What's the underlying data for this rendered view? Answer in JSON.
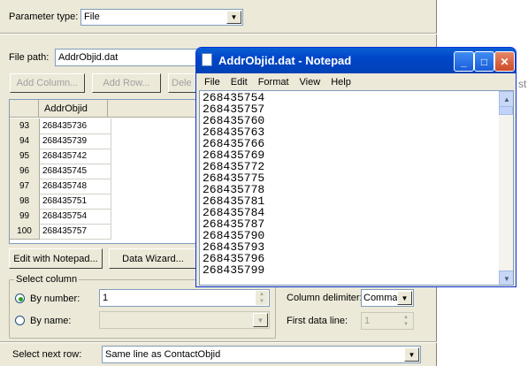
{
  "param_type": {
    "label": "Parameter type:",
    "value": "File"
  },
  "file_path": {
    "label": "File path:",
    "value": "AddrObjid.dat"
  },
  "buttons": {
    "add_column": "Add Column...",
    "add_row": "Add Row...",
    "delete": "Dele"
  },
  "grid": {
    "column_header": "AddrObjid",
    "rows": [
      {
        "num": "93",
        "value": "268435736"
      },
      {
        "num": "94",
        "value": "268435739"
      },
      {
        "num": "95",
        "value": "268435742"
      },
      {
        "num": "96",
        "value": "268435745"
      },
      {
        "num": "97",
        "value": "268435748"
      },
      {
        "num": "98",
        "value": "268435751"
      },
      {
        "num": "99",
        "value": "268435754"
      },
      {
        "num": "100",
        "value": "268435757"
      }
    ]
  },
  "actions": {
    "edit_notepad": "Edit with Notepad...",
    "data_wizard": "Data Wizard..."
  },
  "select_column": {
    "title": "Select column",
    "by_number_label": "By number:",
    "by_number_value": "1",
    "by_name_label": "By name:"
  },
  "delimiter": {
    "label": "Column delimiter:",
    "value": "Comma"
  },
  "first_line": {
    "label": "First data line:",
    "value": "1"
  },
  "next_row": {
    "label": "Select next row:",
    "value": "Same line as ContactObjid"
  },
  "background_fragment": "st",
  "notepad": {
    "title": "AddrObjid.dat - Notepad",
    "menu": [
      "File",
      "Edit",
      "Format",
      "View",
      "Help"
    ],
    "lines": [
      "268435754",
      "268435757",
      "268435760",
      "268435763",
      "268435766",
      "268435769",
      "268435772",
      "268435775",
      "268435778",
      "268435781",
      "268435784",
      "268435787",
      "268435790",
      "268435793",
      "268435796",
      "268435799"
    ]
  }
}
